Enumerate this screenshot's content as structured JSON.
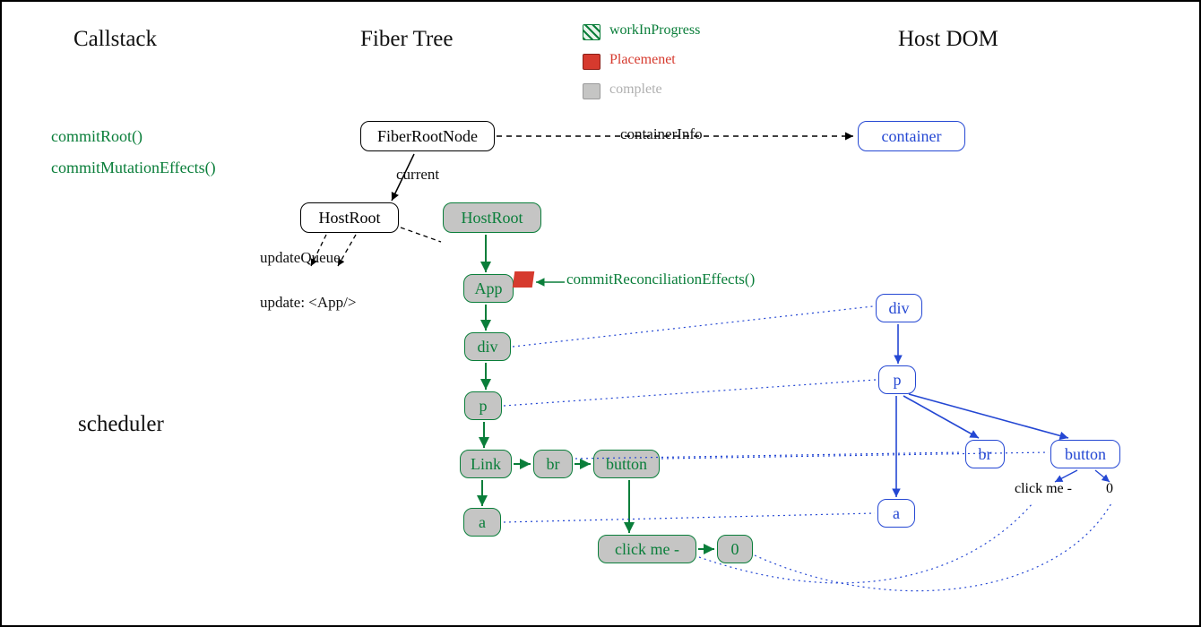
{
  "headers": {
    "callstack": "Callstack",
    "fiber_tree": "Fiber Tree",
    "host_dom": "Host DOM",
    "scheduler": "scheduler"
  },
  "callstack": {
    "fn1": "commitRoot()",
    "fn2": "commitMutationEffects()"
  },
  "legend": {
    "wip": "workInProgress",
    "placement": "Placemenet",
    "complete": "complete"
  },
  "labels": {
    "containerInfo": "containerInfo",
    "current": "current",
    "updateQueue": "updateQueue",
    "updateApp": "update: <App/>",
    "commitReconciliation": "commitReconciliationEffects()"
  },
  "colors": {
    "green": "#0a7e3a",
    "blue": "#2447d3",
    "red": "#d63a2e",
    "grayFill": "#c5c5c4",
    "grayText": "#b0b0b0"
  },
  "whiteNodes": {
    "fiberRootNode": "FiberRootNode",
    "hostRoot": "HostRoot"
  },
  "fiber": {
    "hostRoot": "HostRoot",
    "app": "App",
    "div": "div",
    "p": "p",
    "link": "Link",
    "br": "br",
    "button": "button",
    "a": "a",
    "clickme": "click me -",
    "zero": "0"
  },
  "host": {
    "container": "container",
    "div": "div",
    "p": "p",
    "br": "br",
    "button": "button",
    "a": "a",
    "clickme": "click me -",
    "zero": "0"
  }
}
